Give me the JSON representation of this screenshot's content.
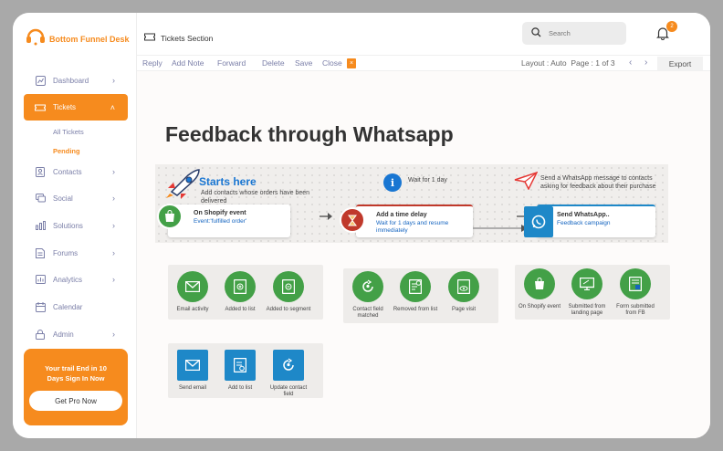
{
  "brand": {
    "name": "Bottom Funnel Desk",
    "accent": "#f68b1e"
  },
  "sidebar": {
    "items": [
      {
        "label": "Dashboard",
        "icon": "chart-icon"
      },
      {
        "label": "Tickets",
        "icon": "ticket-icon"
      },
      {
        "label": "Contacts",
        "icon": "contacts-icon"
      },
      {
        "label": "Social",
        "icon": "social-icon"
      },
      {
        "label": "Solutions",
        "icon": "solutions-icon"
      },
      {
        "label": "Forums",
        "icon": "forums-icon"
      },
      {
        "label": "Analytics",
        "icon": "analytics-icon"
      },
      {
        "label": "Calendar",
        "icon": "calendar-icon"
      },
      {
        "label": "Admin",
        "icon": "lock-icon"
      }
    ],
    "sub_items": [
      "All Tickets",
      "Pending"
    ],
    "promo": {
      "text": "Your trail End in 10 Days Sign In Now",
      "button": "Get Pro Now"
    }
  },
  "header": {
    "breadcrumb": "Tickets Section",
    "search_placeholder": "Search",
    "notification_count": "2"
  },
  "toolbar": {
    "reply": "Reply",
    "add_note": "Add Note",
    "forward": "Forward",
    "delete": "Delete",
    "save": "Save",
    "close": "Close",
    "close_x": "×",
    "pager": "Layout : Auto  Page : 1 of 3",
    "prev": "‹",
    "next": "›",
    "export": "Export"
  },
  "content": {
    "title": "Feedback through Whatsapp",
    "flow": {
      "start_title": "Starts here",
      "start_sub": "Add contacts whose orders have been delivered",
      "wait_note": "Wait for 1 day",
      "send_note": "Send a WhatsApp message to contacts asking for feedback about their purchase",
      "node1": {
        "title": "On Shopify event",
        "sub": "Event:'fulfilled order'"
      },
      "node2": {
        "title": "Add a time delay",
        "sub": "Wait for 1 days and resume immediately"
      },
      "node3": {
        "title": "Send WhatsApp..",
        "sub": "Feedback campaign"
      },
      "info_glyph": "i"
    },
    "group1": [
      "Email activity",
      "Added to list",
      "Added to segment"
    ],
    "group2": [
      "Contact field matched",
      "Removed from list",
      "Page visit"
    ],
    "group3": [
      "On Shopify event",
      "Submitted from landing page",
      "Form submitted from FB"
    ],
    "group4": [
      "Send email",
      "Add to list",
      "Update contact field"
    ]
  }
}
